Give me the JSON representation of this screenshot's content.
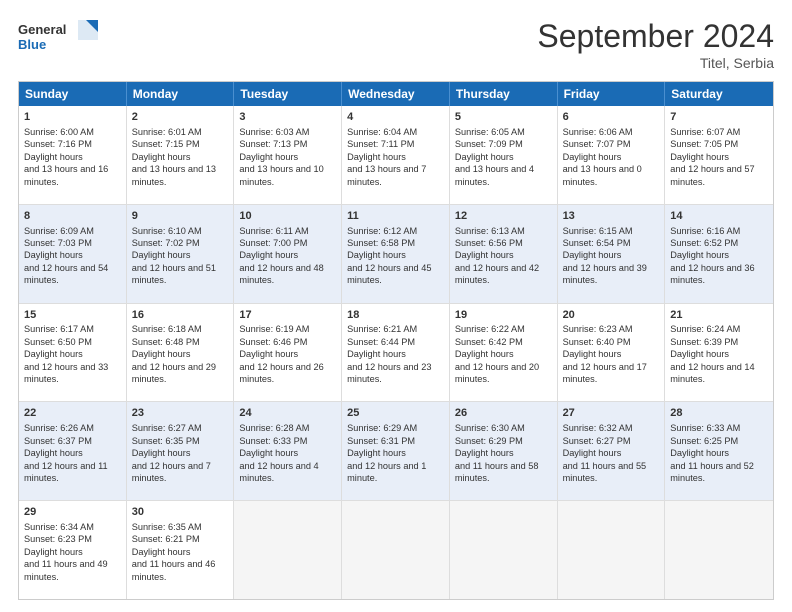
{
  "header": {
    "title": "September 2024",
    "location": "Titel, Serbia",
    "logo_general": "General",
    "logo_blue": "Blue"
  },
  "days_of_week": [
    "Sunday",
    "Monday",
    "Tuesday",
    "Wednesday",
    "Thursday",
    "Friday",
    "Saturday"
  ],
  "rows": [
    [
      {
        "day": "1",
        "sunrise": "6:00 AM",
        "sunset": "7:16 PM",
        "daylight": "13 hours and 16 minutes."
      },
      {
        "day": "2",
        "sunrise": "6:01 AM",
        "sunset": "7:15 PM",
        "daylight": "13 hours and 13 minutes."
      },
      {
        "day": "3",
        "sunrise": "6:03 AM",
        "sunset": "7:13 PM",
        "daylight": "13 hours and 10 minutes."
      },
      {
        "day": "4",
        "sunrise": "6:04 AM",
        "sunset": "7:11 PM",
        "daylight": "13 hours and 7 minutes."
      },
      {
        "day": "5",
        "sunrise": "6:05 AM",
        "sunset": "7:09 PM",
        "daylight": "13 hours and 4 minutes."
      },
      {
        "day": "6",
        "sunrise": "6:06 AM",
        "sunset": "7:07 PM",
        "daylight": "13 hours and 0 minutes."
      },
      {
        "day": "7",
        "sunrise": "6:07 AM",
        "sunset": "7:05 PM",
        "daylight": "12 hours and 57 minutes."
      }
    ],
    [
      {
        "day": "8",
        "sunrise": "6:09 AM",
        "sunset": "7:03 PM",
        "daylight": "12 hours and 54 minutes."
      },
      {
        "day": "9",
        "sunrise": "6:10 AM",
        "sunset": "7:02 PM",
        "daylight": "12 hours and 51 minutes."
      },
      {
        "day": "10",
        "sunrise": "6:11 AM",
        "sunset": "7:00 PM",
        "daylight": "12 hours and 48 minutes."
      },
      {
        "day": "11",
        "sunrise": "6:12 AM",
        "sunset": "6:58 PM",
        "daylight": "12 hours and 45 minutes."
      },
      {
        "day": "12",
        "sunrise": "6:13 AM",
        "sunset": "6:56 PM",
        "daylight": "12 hours and 42 minutes."
      },
      {
        "day": "13",
        "sunrise": "6:15 AM",
        "sunset": "6:54 PM",
        "daylight": "12 hours and 39 minutes."
      },
      {
        "day": "14",
        "sunrise": "6:16 AM",
        "sunset": "6:52 PM",
        "daylight": "12 hours and 36 minutes."
      }
    ],
    [
      {
        "day": "15",
        "sunrise": "6:17 AM",
        "sunset": "6:50 PM",
        "daylight": "12 hours and 33 minutes."
      },
      {
        "day": "16",
        "sunrise": "6:18 AM",
        "sunset": "6:48 PM",
        "daylight": "12 hours and 29 minutes."
      },
      {
        "day": "17",
        "sunrise": "6:19 AM",
        "sunset": "6:46 PM",
        "daylight": "12 hours and 26 minutes."
      },
      {
        "day": "18",
        "sunrise": "6:21 AM",
        "sunset": "6:44 PM",
        "daylight": "12 hours and 23 minutes."
      },
      {
        "day": "19",
        "sunrise": "6:22 AM",
        "sunset": "6:42 PM",
        "daylight": "12 hours and 20 minutes."
      },
      {
        "day": "20",
        "sunrise": "6:23 AM",
        "sunset": "6:40 PM",
        "daylight": "12 hours and 17 minutes."
      },
      {
        "day": "21",
        "sunrise": "6:24 AM",
        "sunset": "6:39 PM",
        "daylight": "12 hours and 14 minutes."
      }
    ],
    [
      {
        "day": "22",
        "sunrise": "6:26 AM",
        "sunset": "6:37 PM",
        "daylight": "12 hours and 11 minutes."
      },
      {
        "day": "23",
        "sunrise": "6:27 AM",
        "sunset": "6:35 PM",
        "daylight": "12 hours and 7 minutes."
      },
      {
        "day": "24",
        "sunrise": "6:28 AM",
        "sunset": "6:33 PM",
        "daylight": "12 hours and 4 minutes."
      },
      {
        "day": "25",
        "sunrise": "6:29 AM",
        "sunset": "6:31 PM",
        "daylight": "12 hours and 1 minute."
      },
      {
        "day": "26",
        "sunrise": "6:30 AM",
        "sunset": "6:29 PM",
        "daylight": "11 hours and 58 minutes."
      },
      {
        "day": "27",
        "sunrise": "6:32 AM",
        "sunset": "6:27 PM",
        "daylight": "11 hours and 55 minutes."
      },
      {
        "day": "28",
        "sunrise": "6:33 AM",
        "sunset": "6:25 PM",
        "daylight": "11 hours and 52 minutes."
      }
    ],
    [
      {
        "day": "29",
        "sunrise": "6:34 AM",
        "sunset": "6:23 PM",
        "daylight": "11 hours and 49 minutes."
      },
      {
        "day": "30",
        "sunrise": "6:35 AM",
        "sunset": "6:21 PM",
        "daylight": "11 hours and 46 minutes."
      },
      null,
      null,
      null,
      null,
      null
    ]
  ]
}
